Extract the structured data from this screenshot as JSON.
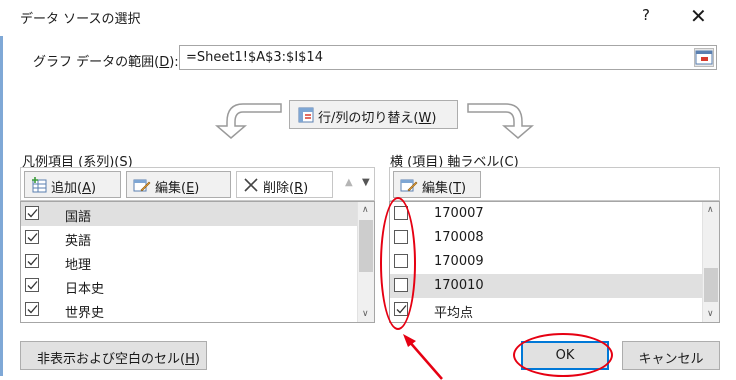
{
  "dialog": {
    "title": "データ ソースの選択",
    "help_glyph": "?",
    "close_glyph": "✕"
  },
  "range": {
    "label_prefix": "グラフ データの範囲(",
    "label_key": "D",
    "label_suffix": "):",
    "value": "=Sheet1!$A$3:$I$14"
  },
  "switch": {
    "label_prefix": "行/列の切り替え(",
    "label_key": "W",
    "label_suffix": ")"
  },
  "legend_panel": {
    "label_prefix": "凡例項目 (系列)(",
    "label_key": "S",
    "label_suffix": ")",
    "add_prefix": "追加(",
    "add_key": "A",
    "add_suffix": ")",
    "edit_prefix": "編集(",
    "edit_key": "E",
    "edit_suffix": ")",
    "delete_prefix": "削除(",
    "delete_key": "R",
    "delete_suffix": ")",
    "up_glyph": "▲",
    "down_glyph": "▼",
    "items": [
      {
        "label": "国語",
        "checked": true,
        "selected": true
      },
      {
        "label": "英語",
        "checked": true,
        "selected": false
      },
      {
        "label": "地理",
        "checked": true,
        "selected": false
      },
      {
        "label": "日本史",
        "checked": true,
        "selected": false
      },
      {
        "label": "世界史",
        "checked": true,
        "selected": false
      }
    ]
  },
  "axis_panel": {
    "label_prefix": "横 (項目) 軸ラベル(",
    "label_key": "C",
    "label_suffix": ")",
    "edit_prefix": "編集(",
    "edit_key": "T",
    "edit_suffix": ")",
    "items": [
      {
        "label": "170007",
        "checked": false,
        "selected": false
      },
      {
        "label": "170008",
        "checked": false,
        "selected": false
      },
      {
        "label": "170009",
        "checked": false,
        "selected": false
      },
      {
        "label": "170010",
        "checked": false,
        "selected": true
      },
      {
        "label": "平均点",
        "checked": true,
        "selected": false
      }
    ]
  },
  "footer": {
    "hidden_prefix": "非表示および空白のセル(",
    "hidden_key": "H",
    "hidden_suffix": ")",
    "ok_label": "OK",
    "cancel_label": "キャンセル"
  },
  "colors": {
    "annotation_red": "#e60012",
    "accent_blue": "#0078d7",
    "selected_row": "#e0e0e0"
  }
}
